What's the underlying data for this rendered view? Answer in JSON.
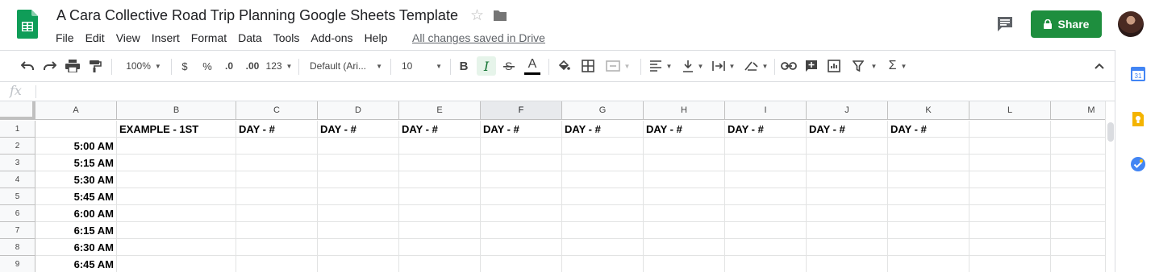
{
  "app": {
    "title": "A Cara Collective Road Trip Planning Google Sheets Template",
    "saved_status": "All changes saved in Drive",
    "share_label": "Share"
  },
  "menu": [
    "File",
    "Edit",
    "View",
    "Insert",
    "Format",
    "Data",
    "Tools",
    "Add-ons",
    "Help"
  ],
  "toolbar": {
    "zoom": "100%",
    "currency": "$",
    "percent": "%",
    "decimal_decrease": ".0",
    "decimal_increase": ".00",
    "more_formats": "123",
    "font": "Default (Ari...",
    "font_size": "10",
    "bold": "B",
    "italic": "I",
    "text_color": "A",
    "sum": "Σ"
  },
  "formula_bar": {
    "fx": "fx",
    "value": ""
  },
  "colors": {
    "share_green": "#1e8e3e",
    "sheets_green": "#0f9d58",
    "italic_active_bg": "#e6f4ea",
    "calendar_blue": "#4285f4",
    "keep_yellow": "#f4b400",
    "tasks_blue": "#4285f4"
  },
  "side_panel": {
    "icons": [
      "calendar-icon",
      "keep-icon",
      "tasks-icon"
    ],
    "calendar_day": "31"
  },
  "grid": {
    "columns": [
      "A",
      "B",
      "C",
      "D",
      "E",
      "F",
      "G",
      "H",
      "I",
      "J",
      "K",
      "L",
      "M"
    ],
    "selected_column": "F",
    "rows": [
      {
        "num": "1",
        "cells": [
          "",
          "EXAMPLE - 1ST",
          "DAY - #",
          "DAY - #",
          "DAY - #",
          "DAY - #",
          "DAY - #",
          "DAY - #",
          "DAY - #",
          "DAY - #",
          "DAY - #",
          "",
          ""
        ]
      },
      {
        "num": "2",
        "cells": [
          "5:00 AM",
          "",
          "",
          "",
          "",
          "",
          "",
          "",
          "",
          "",
          "",
          "",
          ""
        ]
      },
      {
        "num": "3",
        "cells": [
          "5:15 AM",
          "",
          "",
          "",
          "",
          "",
          "",
          "",
          "",
          "",
          "",
          "",
          ""
        ]
      },
      {
        "num": "4",
        "cells": [
          "5:30 AM",
          "",
          "",
          "",
          "",
          "",
          "",
          "",
          "",
          "",
          "",
          "",
          ""
        ]
      },
      {
        "num": "5",
        "cells": [
          "5:45 AM",
          "",
          "",
          "",
          "",
          "",
          "",
          "",
          "",
          "",
          "",
          "",
          ""
        ]
      },
      {
        "num": "6",
        "cells": [
          "6:00 AM",
          "",
          "",
          "",
          "",
          "",
          "",
          "",
          "",
          "",
          "",
          "",
          ""
        ]
      },
      {
        "num": "7",
        "cells": [
          "6:15 AM",
          "",
          "",
          "",
          "",
          "",
          "",
          "",
          "",
          "",
          "",
          "",
          ""
        ]
      },
      {
        "num": "8",
        "cells": [
          "6:30 AM",
          "",
          "",
          "",
          "",
          "",
          "",
          "",
          "",
          "",
          "",
          "",
          ""
        ]
      },
      {
        "num": "9",
        "cells": [
          "6:45 AM",
          "",
          "",
          "",
          "",
          "",
          "",
          "",
          "",
          "",
          "",
          "",
          ""
        ]
      }
    ]
  }
}
